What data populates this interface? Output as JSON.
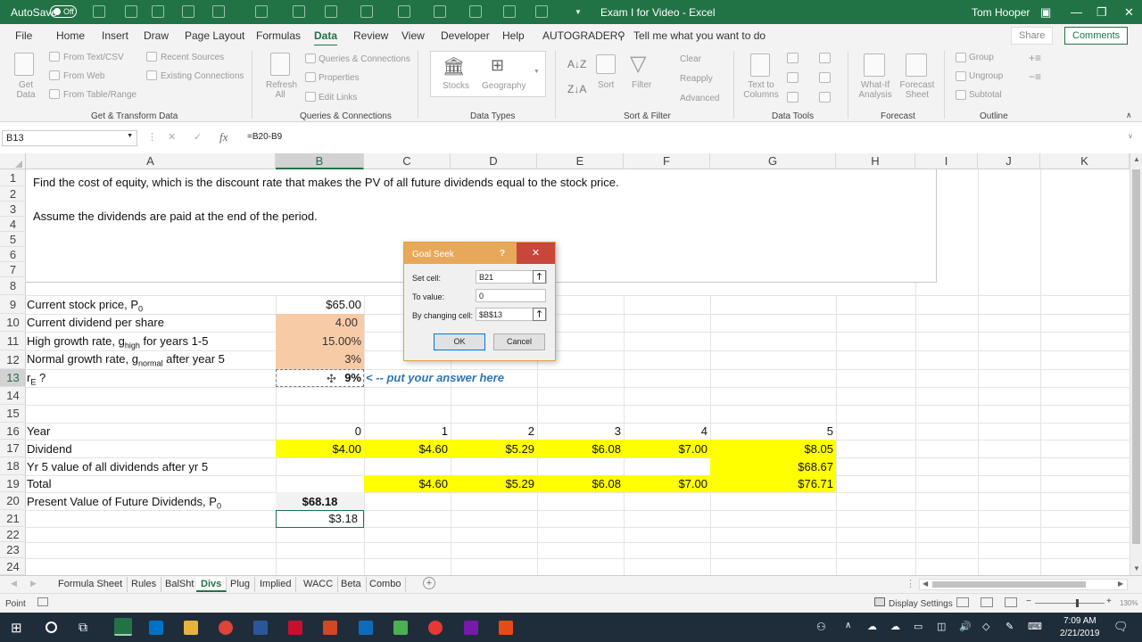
{
  "title_bar": {
    "autosave_label": "AutoSave",
    "autosave_state": "Off",
    "document_title": "Exam I for Video  -  Excel",
    "user_name": "Tom Hooper"
  },
  "ribbon_tabs": [
    "File",
    "Home",
    "Insert",
    "Draw",
    "Page Layout",
    "Formulas",
    "Data",
    "Review",
    "View",
    "Developer",
    "Help",
    "AUTOGRADER"
  ],
  "active_tab": "Data",
  "tell_me": "Tell me what you want to do",
  "share_label": "Share",
  "comments_label": "Comments",
  "ribbon": {
    "get_data": "Get Data",
    "from_text_csv": "From Text/CSV",
    "from_web": "From Web",
    "from_table_range": "From Table/Range",
    "recent_sources": "Recent Sources",
    "existing_connections": "Existing Connections",
    "group_get_transform": "Get & Transform Data",
    "refresh_all": "Refresh All",
    "queries_connections": "Queries & Connections",
    "properties": "Properties",
    "edit_links": "Edit Links",
    "group_queries": "Queries & Connections",
    "stocks": "Stocks",
    "geography": "Geography",
    "group_data_types": "Data Types",
    "sort": "Sort",
    "filter": "Filter",
    "clear": "Clear",
    "reapply": "Reapply",
    "advanced": "Advanced",
    "group_sort_filter": "Sort & Filter",
    "text_to_columns": "Text to Columns",
    "group_data_tools": "Data Tools",
    "what_if": "What-If Analysis",
    "forecast_sheet": "Forecast Sheet",
    "group_forecast": "Forecast",
    "group": "Group",
    "ungroup": "Ungroup",
    "subtotal": "Subtotal",
    "group_outline": "Outline"
  },
  "formula_bar": {
    "name_box": "B13",
    "fx": "fx",
    "formula": "=B20-B9"
  },
  "columns": [
    "A",
    "B",
    "C",
    "D",
    "E",
    "F",
    "G",
    "H",
    "I",
    "J",
    "K"
  ],
  "rows": [
    "1",
    "2",
    "3",
    "4",
    "5",
    "6",
    "7",
    "8",
    "9",
    "10",
    "11",
    "12",
    "13",
    "14",
    "15",
    "16",
    "17",
    "18",
    "19",
    "20",
    "21",
    "22",
    "23",
    "24"
  ],
  "instructions": {
    "line1": "Find the cost of equity, which is the discount rate that makes the PV of all future dividends equal to the stock price.",
    "line2": "Assume the dividends are paid at the end of the period."
  },
  "inputs": {
    "price_label": "Current stock price, P",
    "price_sub": "0",
    "price_value": "$65.00",
    "div_label": "Current dividend per share",
    "div_value": "4.00",
    "high_label_a": "High growth rate, g",
    "high_sub": "high",
    "high_label_b": " for years 1-5",
    "high_value": "15.00%",
    "normal_label_a": "Normal growth rate, g",
    "normal_sub": "normal",
    "normal_label_b": " after year 5",
    "normal_value": "3%",
    "re_label_a": "r",
    "re_sub": "E",
    "re_label_b": " ?",
    "re_value": "9%",
    "answer_note": "< -- put your answer here"
  },
  "table": {
    "year_label": "Year",
    "dividend_label": "Dividend",
    "yr5_label": "Yr 5 value of all dividends after yr 5",
    "total_label": "Total",
    "years": [
      "0",
      "1",
      "2",
      "3",
      "4",
      "5"
    ],
    "dividends": [
      "$4.00",
      "$4.60",
      "$5.29",
      "$6.08",
      "$7.00",
      "$8.05"
    ],
    "yr5_value": "$68.67",
    "totals": [
      "$4.60",
      "$5.29",
      "$6.08",
      "$7.00",
      "$76.71"
    ],
    "pv_label": "Present Value of Future Dividends, P",
    "pv_sub": "0",
    "pv_value": "$68.18",
    "diff_value": "$3.18"
  },
  "goal_seek": {
    "title": "Goal Seek",
    "help": "?",
    "close": "✕",
    "set_cell_label": "Set cell:",
    "set_cell_value": "B21",
    "to_value_label": "To value:",
    "to_value_value": "0",
    "changing_label": "By changing cell:",
    "changing_value": "$B$13",
    "ok": "OK",
    "cancel": "Cancel"
  },
  "sheet_tabs": [
    "Formula Sheet",
    "Rules",
    "BalSht",
    "Divs",
    "Plug",
    "Implied",
    "WACC",
    "Beta",
    "Combo"
  ],
  "active_sheet": "Divs",
  "status": {
    "mode": "Point",
    "display_settings": "Display Settings",
    "zoom": "130%"
  },
  "taskbar": {
    "time": "7:09 AM",
    "date": "2/21/2019"
  },
  "colors": {
    "excel_green": "#217346",
    "orange_fill": "#f8cba7",
    "yellow_fill": "#ffff00",
    "answer_blue": "#2e75b6"
  }
}
